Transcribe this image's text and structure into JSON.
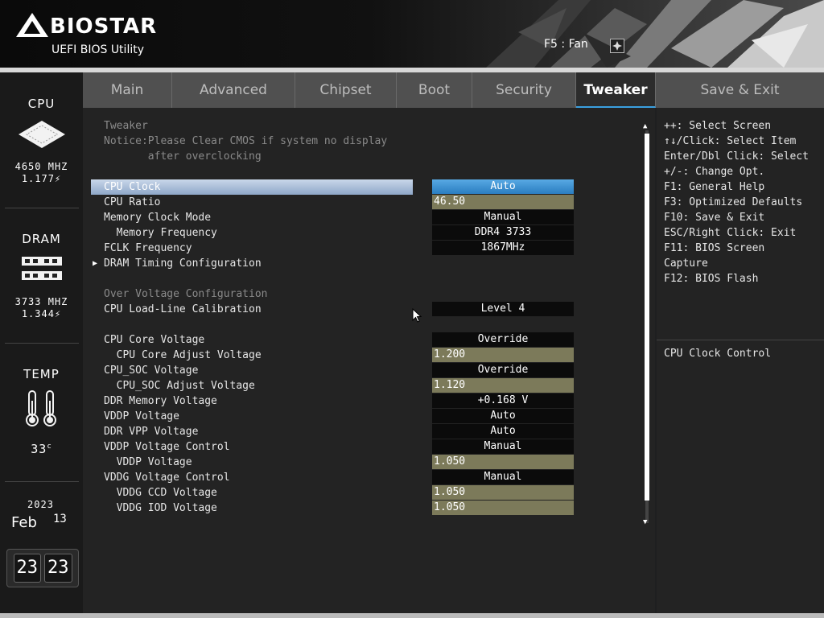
{
  "header": {
    "brand": "BIOSTAR",
    "subtitle": "UEFI BIOS Utility",
    "fan_hint": "F5 : Fan"
  },
  "status": {
    "cpu": {
      "title": "CPU",
      "freq": "4650 MHZ",
      "volt": "1.177"
    },
    "dram": {
      "title": "DRAM",
      "freq": "3733 MHZ",
      "volt": "1.344"
    },
    "temp": {
      "title": "TEMP",
      "value": "33",
      "unit": "c"
    },
    "date": {
      "year": "2023",
      "month": "Feb",
      "day": "13"
    },
    "time": {
      "hour": "23",
      "minute": "23"
    }
  },
  "tabs": [
    {
      "label": "Main"
    },
    {
      "label": "Advanced"
    },
    {
      "label": "Chipset"
    },
    {
      "label": "Boot"
    },
    {
      "label": "Security"
    },
    {
      "label": "Tweaker"
    },
    {
      "label": "Save & Exit"
    }
  ],
  "active_tab": "Tweaker",
  "main": {
    "heading": "Tweaker",
    "notice_1": "Notice:Please Clear CMOS if system no display",
    "notice_2": "       after overclocking",
    "section_voltage": "Over Voltage Configuration",
    "rows": [
      {
        "label": "CPU Clock",
        "value": "Auto"
      },
      {
        "label": "CPU Ratio",
        "value": "46.50"
      },
      {
        "label": "Memory Clock Mode",
        "value": "Manual"
      },
      {
        "label": "  Memory Frequency",
        "value": "DDR4 3733"
      },
      {
        "label": "FCLK Frequency",
        "value": "1867MHz"
      },
      {
        "label": "DRAM Timing Configuration",
        "value": ""
      },
      {
        "label": "CPU Load-Line Calibration",
        "value": "Level 4"
      },
      {
        "label": "CPU Core Voltage",
        "value": "Override"
      },
      {
        "label": "  CPU Core Adjust Voltage",
        "value": "1.200"
      },
      {
        "label": "CPU_SOC Voltage",
        "value": "Override"
      },
      {
        "label": "  CPU_SOC Adjust Voltage",
        "value": "1.120"
      },
      {
        "label": "DDR Memory Voltage",
        "value": "+0.168 V"
      },
      {
        "label": "VDDP Voltage",
        "value": "Auto"
      },
      {
        "label": "DDR VPP Voltage",
        "value": "Auto"
      },
      {
        "label": "VDDP Voltage Control",
        "value": "Manual"
      },
      {
        "label": "  VDDP Voltage",
        "value": "1.050"
      },
      {
        "label": "VDDG Voltage Control",
        "value": "Manual"
      },
      {
        "label": "  VDDG CCD Voltage",
        "value": "1.050"
      },
      {
        "label": "  VDDG IOD Voltage",
        "value": "1.050"
      }
    ]
  },
  "help": {
    "keys": [
      "++: Select Screen",
      "↑↓/Click: Select Item",
      "Enter/Dbl Click: Select",
      "+/-: Change Opt.",
      "F1: General Help",
      "F3: Optimized Defaults",
      "F10: Save & Exit",
      "ESC/Right Click: Exit",
      "F11: BIOS Screen",
      "Capture",
      "F12: BIOS Flash"
    ],
    "description": "CPU Clock Control"
  }
}
